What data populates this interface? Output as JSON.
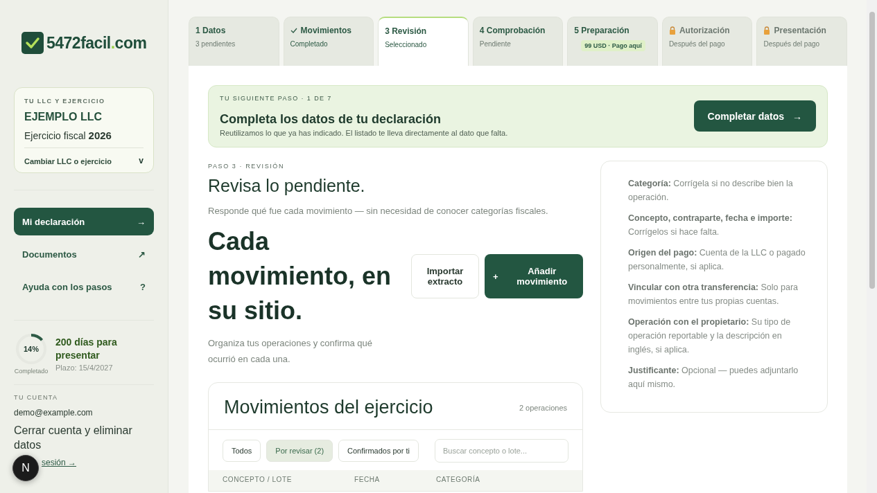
{
  "sidebar": {
    "logo": {
      "parts": [
        "5472facil",
        ".",
        "com"
      ]
    },
    "llc_card": {
      "eyebrow": "TU LLC Y EJERCICIO",
      "name": "EJEMPLO LLC",
      "fiscal_label": "Ejercicio fiscal",
      "fiscal_year": "2026",
      "switch_label": "Cambiar LLC o ejercicio",
      "switch_icon": "v"
    },
    "nav": [
      {
        "label": "Mi declaración",
        "icon": "→",
        "selected": true
      },
      {
        "label": "Documentos",
        "icon": "↗",
        "selected": false
      },
      {
        "label": "Ayuda con los pasos",
        "icon": "?",
        "selected": false
      }
    ],
    "progress": {
      "level": 0.14,
      "percent": "14%",
      "caption": "Completado",
      "days": "200 días para presentar",
      "deadline": "Plazo: 15/4/2027"
    },
    "account": {
      "eyebrow": "TU CUENTA",
      "email": "demo@example.com",
      "delete_link": "Cerrar cuenta y eliminar datos",
      "logout_link": "sesión →"
    },
    "dev_badge": "N"
  },
  "steps": [
    {
      "label": "1 Datos",
      "status": "3 pendientes",
      "kind": "pending",
      "selected": false
    },
    {
      "label": "Movimientos",
      "status": "Completado",
      "kind": "done",
      "selected": false
    },
    {
      "label": "3 Revisión",
      "status": "Seleccionado",
      "kind": "pending",
      "selected": true
    },
    {
      "label": "4 Comprobación",
      "status": "Pendiente",
      "kind": "pending",
      "selected": false
    },
    {
      "label": "5 Preparación",
      "badge": "99 USD · Pago aquí",
      "kind": "pending",
      "selected": false
    },
    {
      "label": "Autorización",
      "status": "Después del pago",
      "kind": "locked",
      "selected": false
    },
    {
      "label": "Presentación",
      "status": "Después del pago",
      "kind": "locked",
      "selected": false
    }
  ],
  "next_step": {
    "eyebrow": "TU SIGUIENTE PASO · 1 DE 7",
    "title": "Completa los datos de tu declaración",
    "text": "Reutilizamos lo que ya has indicado. El listado te lleva directamente al dato que falta.",
    "button": "Completar datos",
    "button_icon": "→"
  },
  "review": {
    "eyebrow": "PASO 3 · REVISIÓN",
    "title": "Revisa lo pendiente.",
    "subtitle": "Responde qué fue cada movimiento — sin necesidad de conocer categorías fiscales.",
    "headline": "Cada movimiento, en su sitio.",
    "description": "Organiza tus operaciones y confirma qué ocurrió en cada una.",
    "import_button": "Importar extracto",
    "add_button": "Añadir movimiento",
    "add_icon": "+"
  },
  "help": [
    {
      "text": "**Categoría:** Corrígela si no describe bien la operación."
    },
    {
      "text": "**Concepto, contraparte, fecha e importe:** Corrígelos si hace falta."
    },
    {
      "text": "**Origen del pago:** Cuenta de la LLC o pagado personalmente, si aplica."
    },
    {
      "text": "**Vincular con otra transferencia:** Solo para movimientos entre tus propias cuentas."
    },
    {
      "text": "**Operación con el propietario:** Su tipo de operación reportable y la descripción en inglés, si aplica."
    },
    {
      "text": "**Justificante:** Opcional — puedes adjuntarlo aquí mismo."
    }
  ],
  "table": {
    "title": "Movimientos del ejercicio",
    "count": "2 operaciones",
    "filters": [
      {
        "label": "Todos",
        "selected": false
      },
      {
        "label": "Por revisar (2)",
        "selected": true
      },
      {
        "label": "Confirmados por ti",
        "selected": false
      }
    ],
    "search": {
      "placeholder": "Buscar concepto o lote..."
    },
    "columns": [
      "CONCEPTO / LOTE",
      "FECHA",
      "CATEGORÍA"
    ]
  }
}
